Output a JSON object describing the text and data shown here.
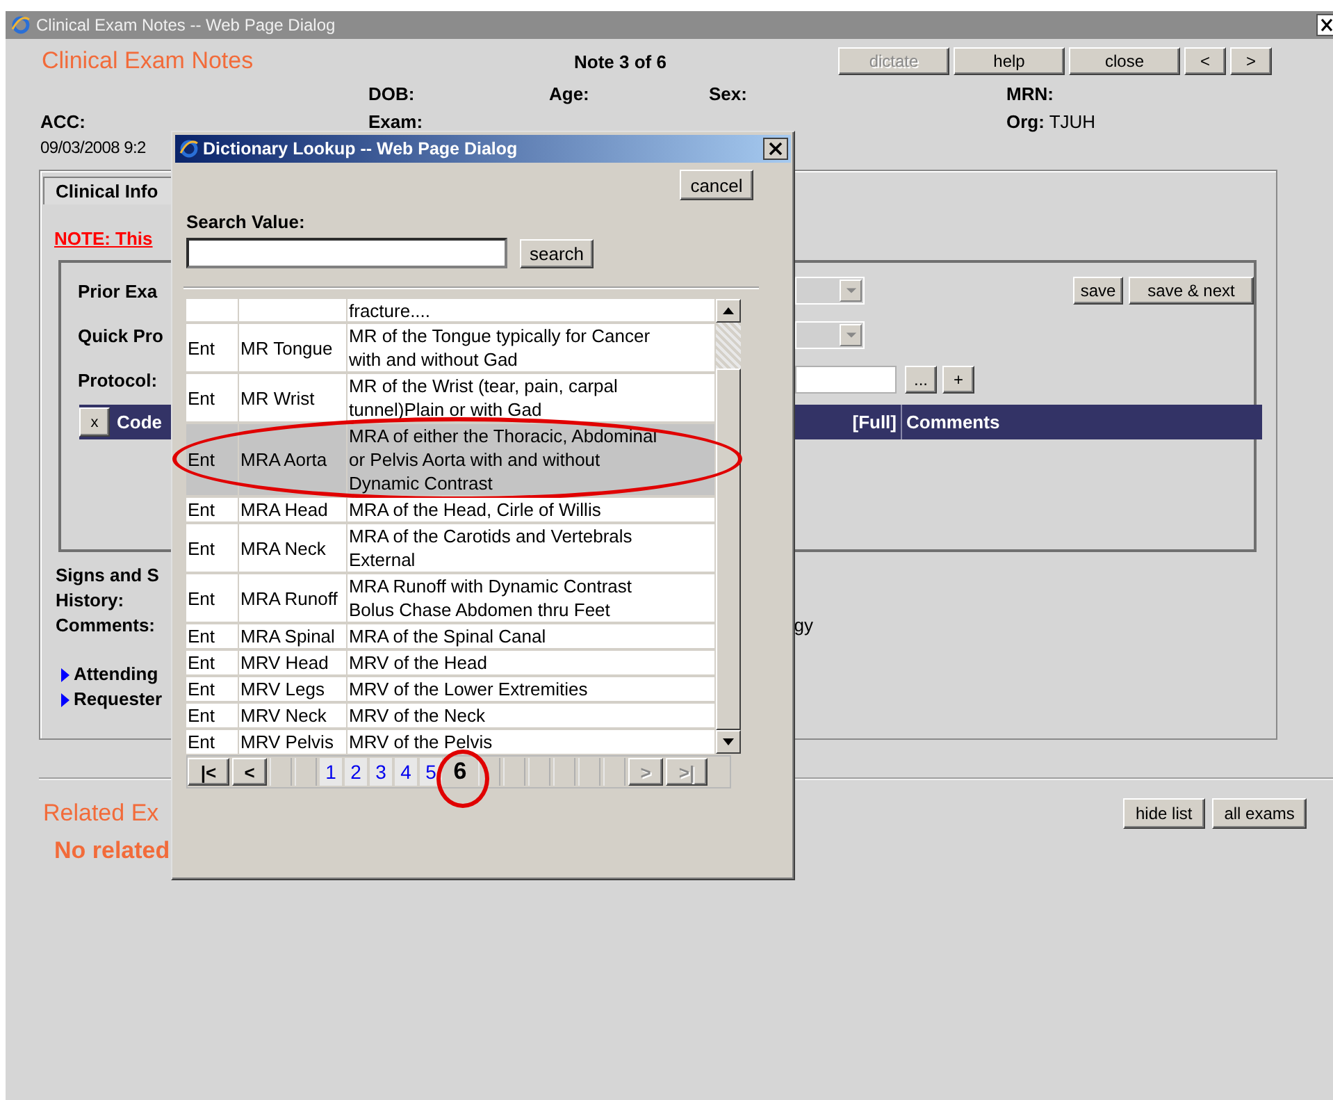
{
  "window": {
    "title": "Clinical Exam Notes -- Web Page Dialog"
  },
  "header": {
    "title": "Clinical Exam Notes",
    "note_position": "Note 3 of 6",
    "buttons": [
      {
        "label": "dictate",
        "disabled": true
      },
      {
        "label": "help",
        "disabled": false
      },
      {
        "label": "close",
        "disabled": false
      },
      {
        "label": "<",
        "disabled": false
      },
      {
        "label": ">",
        "disabled": false
      }
    ]
  },
  "patient": {
    "dob_label": "DOB:",
    "age_label": "Age:",
    "sex_label": "Sex:",
    "mrn_label": "MRN:",
    "acc_label": "ACC:",
    "exam_label": "Exam:",
    "org_label": "Org:",
    "org": "TJUH",
    "date": "09/03/2008 9:2"
  },
  "panel": {
    "tab": "Clinical Info",
    "note": "NOTE: This",
    "prior_exam_label": "Prior Exa",
    "quick_protocol_label": "Quick Pro",
    "protocol_label": "Protocol:",
    "browse_button": "...",
    "add_button": "+",
    "save_buttons": [
      "save",
      "save & next"
    ],
    "grid": {
      "remove_button": "x",
      "columns": [
        "Code",
        "[Full]",
        "Comments"
      ]
    },
    "signs_label": "Signs and S",
    "history_label": "History:",
    "comments_label": "Comments:",
    "comments_tail": "gy",
    "links": [
      "Attending",
      "Requester"
    ]
  },
  "related": {
    "title": "Related Ex",
    "empty": "No related",
    "buttons": [
      "hide list",
      "all exams"
    ]
  },
  "lookup": {
    "title": "Dictionary Lookup -- Web Page Dialog",
    "cancel_button": "cancel",
    "search_label": "Search Value:",
    "search_button": "search",
    "rows": [
      {
        "description": "fracture....",
        "selected": false,
        "circled": false
      },
      {
        "source": "Ent",
        "code": "MR Tongue",
        "description": "MR of the Tongue typically for Cancer with and without Gad",
        "selected": false,
        "circled": false
      },
      {
        "source": "Ent",
        "code": "MR Wrist",
        "description": "MR of the Wrist (tear, pain, carpal tunnel)Plain or with Gad",
        "selected": false,
        "circled": false
      },
      {
        "source": "Ent",
        "code": "MRA Aorta",
        "description": "MRA of either the Thoracic, Abdominal or Pelvis Aorta with and without Dynamic Contrast",
        "selected": true,
        "circled": true
      },
      {
        "source": "Ent",
        "code": "MRA Head",
        "description": "MRA of the Head, Cirle of Willis",
        "selected": false,
        "circled": false
      },
      {
        "source": "Ent",
        "code": "MRA Neck",
        "description": "MRA of the Carotids and Vertebrals External",
        "selected": false,
        "circled": false
      },
      {
        "source": "Ent",
        "code": "MRA Runoff",
        "description": "MRA Runoff with Dynamic Contrast Bolus Chase Abdomen thru Feet",
        "selected": false,
        "circled": false
      },
      {
        "source": "Ent",
        "code": "MRA Spinal",
        "description": "MRA of the Spinal Canal",
        "selected": false,
        "circled": false
      },
      {
        "source": "Ent",
        "code": "MRV Head",
        "description": "MRV of the Head",
        "selected": false,
        "circled": false
      },
      {
        "source": "Ent",
        "code": "MRV Legs",
        "description": "MRV of the Lower Extremities",
        "selected": false,
        "circled": false
      },
      {
        "source": "Ent",
        "code": "MRV Neck",
        "description": "MRV of the Neck",
        "selected": false,
        "circled": false
      },
      {
        "source": "Ent",
        "code": "MRV Pelvis",
        "description": "MRV of the Pelvis",
        "selected": false,
        "circled": false
      }
    ],
    "pager": {
      "nav_before": [
        {
          "label": "|<",
          "disabled": false
        },
        {
          "label": "<",
          "disabled": false
        }
      ],
      "pages": [
        {
          "label": "1",
          "selected": false,
          "circled": false
        },
        {
          "label": "2",
          "selected": false,
          "circled": false
        },
        {
          "label": "3",
          "selected": false,
          "circled": false
        },
        {
          "label": "4",
          "selected": false,
          "circled": false
        },
        {
          "label": "5",
          "selected": false,
          "circled": false
        },
        {
          "label": "6",
          "selected": true,
          "circled": true
        }
      ],
      "nav_after": [
        {
          "label": ">",
          "disabled": true
        },
        {
          "label": ">|",
          "disabled": true
        }
      ]
    }
  }
}
